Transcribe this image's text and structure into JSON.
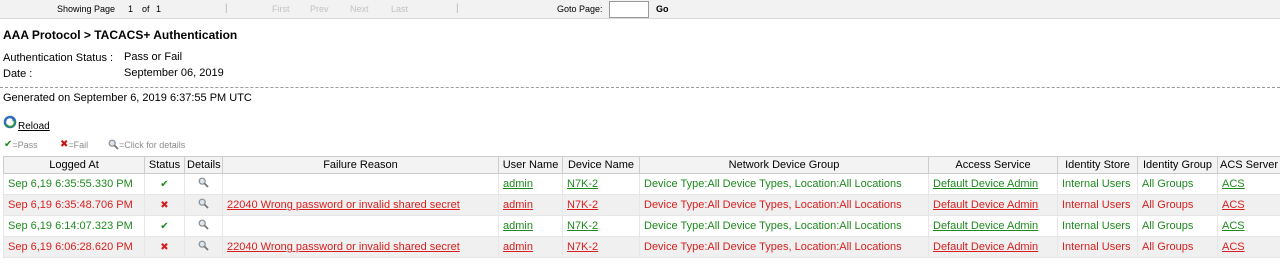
{
  "pager": {
    "showing_label": "Showing Page",
    "current_page": "1",
    "of_label": "of",
    "total_pages": "1",
    "separator": "|",
    "first": "First",
    "prev": "Prev",
    "next": "Next",
    "last": "Last",
    "goto_label": "Goto Page:",
    "goto_value": "",
    "go": "Go"
  },
  "report": {
    "title": "AAA Protocol > TACACS+ Authentication",
    "auth_status_label": "Authentication Status :",
    "auth_status_value": "Pass or Fail",
    "date_label": "Date :",
    "date_value": "September 06, 2019",
    "generated": "Generated on September 6, 2019 6:37:55 PM UTC",
    "reload": "Reload"
  },
  "legend": {
    "pass": "=Pass",
    "fail": "=Fail",
    "details": "=Click for details"
  },
  "colors": {
    "pass": "#1e8a1e",
    "fail": "#d81f1f"
  },
  "table": {
    "columns": [
      "Logged At",
      "Status",
      "Details",
      "Failure Reason",
      "User Name",
      "Device Name",
      "Network Device Group",
      "Access Service",
      "Identity Store",
      "Identity Group",
      "ACS Server"
    ],
    "rows": [
      {
        "logged_at": "Sep 6,19 6:35:55.330 PM",
        "status": "pass",
        "status_glyph": "✔",
        "failure_reason": "",
        "user_name": "admin",
        "device_name": "N7K-2",
        "network_device_group": "Device Type:All Device Types, Location:All Locations",
        "access_service": "Default Device Admin",
        "identity_store": "Internal Users",
        "identity_group": "All Groups",
        "acs_server": "ACS"
      },
      {
        "logged_at": "Sep 6,19 6:35:48.706 PM",
        "status": "fail",
        "status_glyph": "✖",
        "failure_reason": "22040 Wrong password or invalid shared secret",
        "user_name": "admin",
        "device_name": "N7K-2",
        "network_device_group": "Device Type:All Device Types, Location:All Locations",
        "access_service": "Default Device Admin",
        "identity_store": "Internal Users",
        "identity_group": "All Groups",
        "acs_server": "ACS"
      },
      {
        "logged_at": "Sep 6,19 6:14:07.323 PM",
        "status": "pass",
        "status_glyph": "✔",
        "failure_reason": "",
        "user_name": "admin",
        "device_name": "N7K-2",
        "network_device_group": "Device Type:All Device Types, Location:All Locations",
        "access_service": "Default Device Admin",
        "identity_store": "Internal Users",
        "identity_group": "All Groups",
        "acs_server": "ACS"
      },
      {
        "logged_at": "Sep 6,19 6:06:28.620 PM",
        "status": "fail",
        "status_glyph": "✖",
        "failure_reason": "22040 Wrong password or invalid shared secret",
        "user_name": "admin",
        "device_name": "N7K-2",
        "network_device_group": "Device Type:All Device Types, Location:All Locations",
        "access_service": "Default Device Admin",
        "identity_store": "Internal Users",
        "identity_group": "All Groups",
        "acs_server": "ACS"
      }
    ]
  }
}
